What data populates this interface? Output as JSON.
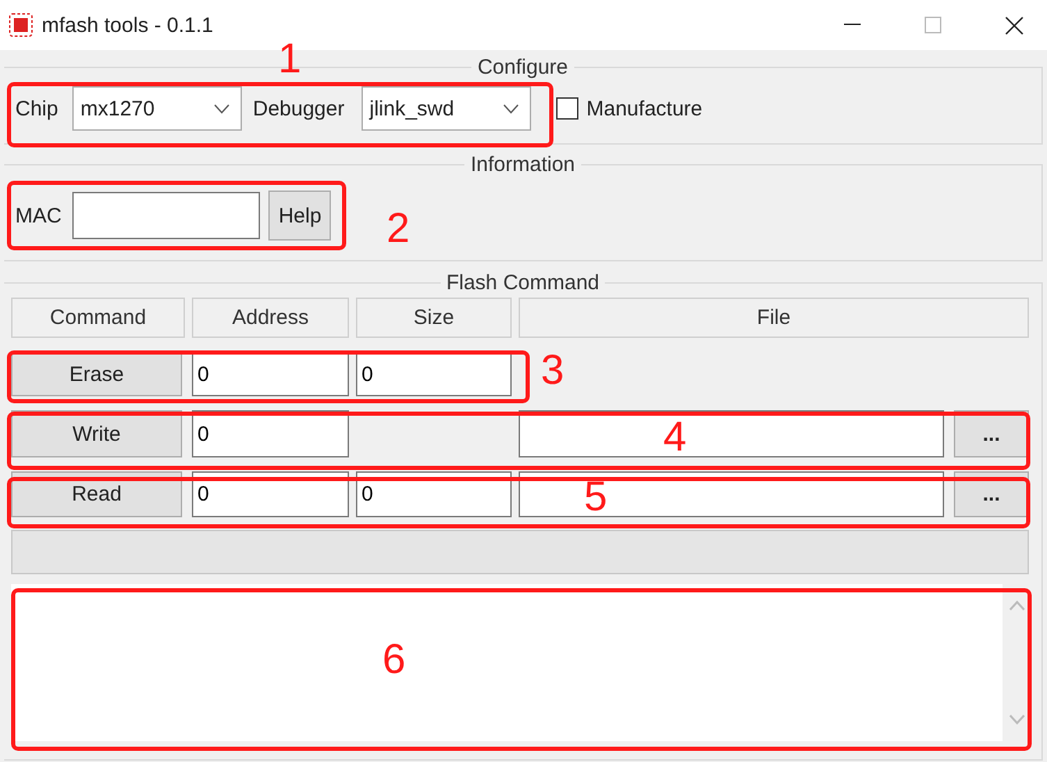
{
  "window": {
    "title": "mfash tools - 0.1.1"
  },
  "configure": {
    "title": "Configure",
    "chip": {
      "label": "Chip",
      "value": "mx1270"
    },
    "debugger": {
      "label": "Debugger",
      "value": "jlink_swd"
    },
    "manufacture": {
      "label": "Manufacture",
      "checked": false
    }
  },
  "information": {
    "title": "Information",
    "mac": {
      "label": "MAC"
    },
    "help_button": "Help"
  },
  "flash_command": {
    "title": "Flash Command",
    "columns": [
      "Command",
      "Address",
      "Size",
      "File"
    ],
    "rows": [
      {
        "kind": "erase",
        "command": "Erase",
        "address": "0",
        "size": "0"
      },
      {
        "kind": "write",
        "command": "Write",
        "address": "0",
        "browse": "..."
      },
      {
        "kind": "read",
        "command": "Read",
        "address": "0",
        "size": "0",
        "browse": "..."
      }
    ]
  },
  "annotations": [
    {
      "label": "1"
    },
    {
      "label": "2"
    },
    {
      "label": "3"
    },
    {
      "label": "4"
    },
    {
      "label": "5"
    },
    {
      "label": "6"
    }
  ]
}
